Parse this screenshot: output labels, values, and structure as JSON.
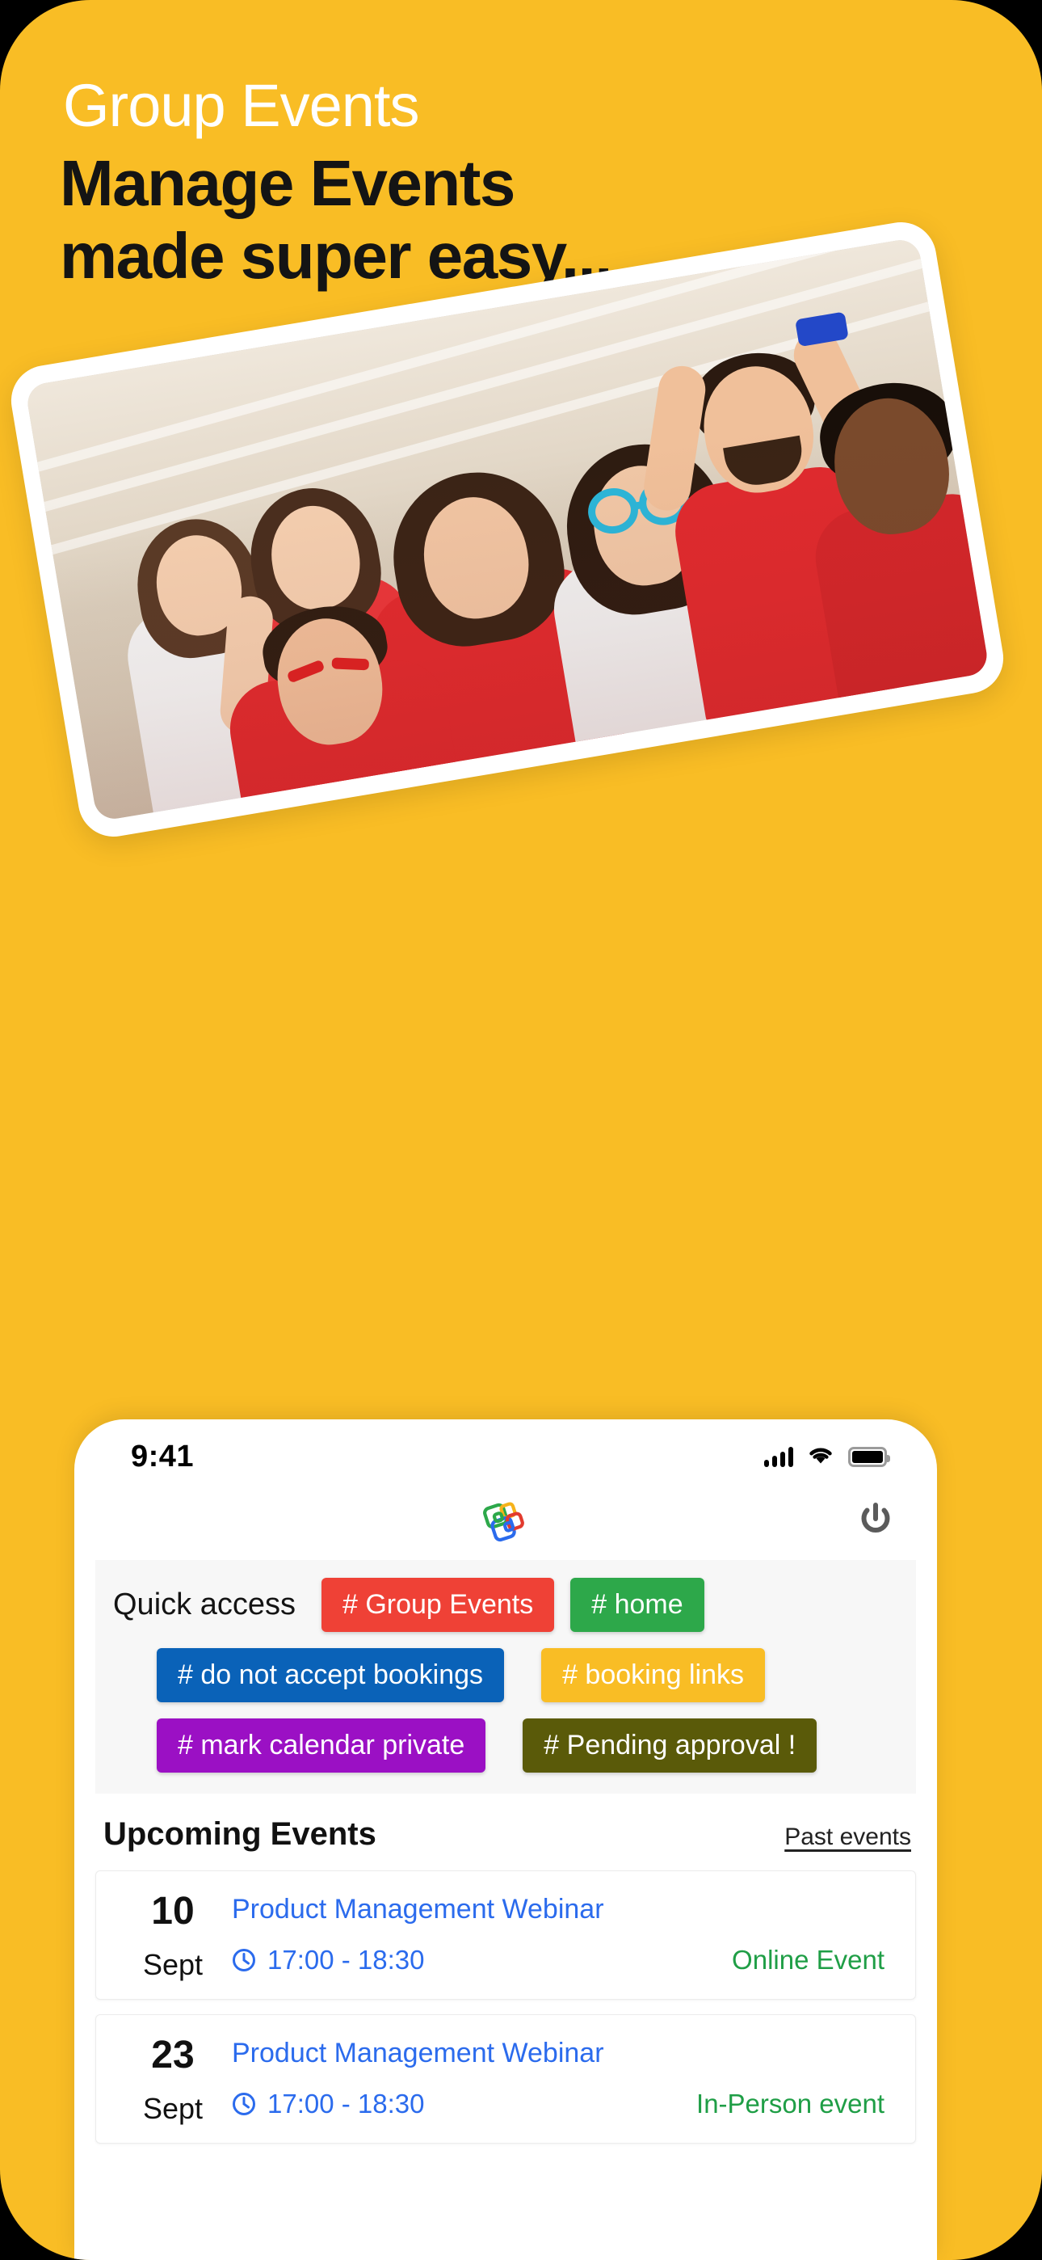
{
  "poster": {
    "background_color": "#F9BD25",
    "eyebrow": "Group Events",
    "headline_line1": "Manage Events",
    "headline_line2": "made super easy...",
    "photo_alt": "group-of-cheering-friends-in-red-shirts"
  },
  "phone": {
    "statusbar": {
      "time": "9:41",
      "signal_icon": "cellular-signal-icon",
      "wifi_icon": "wifi-icon",
      "battery_icon": "battery-full-icon"
    },
    "header": {
      "logo_icon": "app-logo-icon",
      "power_icon": "power-icon"
    },
    "quick_access": {
      "label": "Quick access",
      "chips": [
        {
          "label": "# Group Events",
          "color": "#EF4136"
        },
        {
          "label": "# home",
          "color": "#2DA84A"
        },
        {
          "label": "# do not accept bookings",
          "color": "#0A62B8"
        },
        {
          "label": "# booking links",
          "color": "#F9BD25"
        },
        {
          "label": "# mark calendar private",
          "color": "#9B10C4"
        },
        {
          "label": "# Pending approval !",
          "color": "#5A5A09"
        }
      ]
    },
    "events": {
      "title": "Upcoming Events",
      "past_link": "Past events",
      "items": [
        {
          "day": "10",
          "month": "Sept",
          "title": "Product Management Webinar",
          "time": "17:00 - 18:30",
          "mode": "Online Event",
          "clock_icon": "clock-icon"
        },
        {
          "day": "23",
          "month": "Sept",
          "title": "Product Management Webinar",
          "time": "17:00 - 18:30",
          "mode": "In-Person event",
          "clock_icon": "clock-icon"
        }
      ]
    }
  }
}
